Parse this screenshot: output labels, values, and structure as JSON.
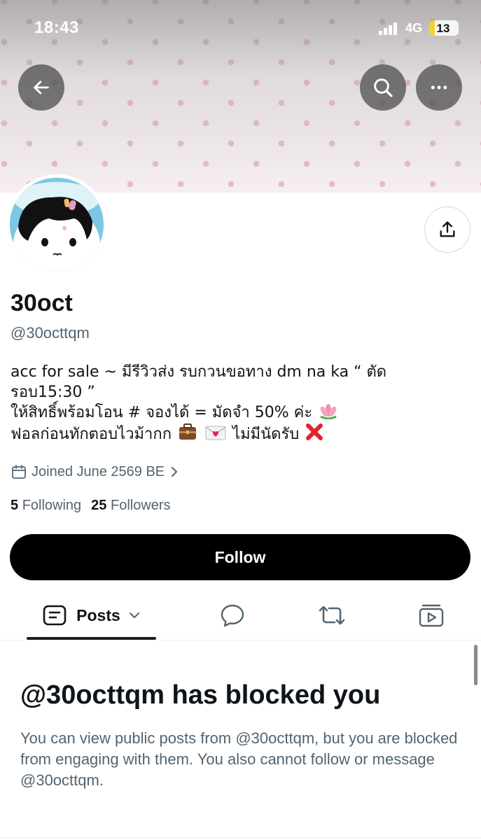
{
  "status_bar": {
    "time": "18:43",
    "network": "4G",
    "battery": "13",
    "battery_color": "#f2d036"
  },
  "header": {
    "back_icon": "arrow-left-icon",
    "search_icon": "search-icon",
    "more_icon": "more-horizontal-icon",
    "share_icon": "share-icon"
  },
  "profile": {
    "display_name": "30oct",
    "handle": "@30octtqm",
    "bio_lines": [
      "acc for sale ~ มีรีวิวส่ง รบกวนขอทาง dm na ka “ ตัด",
      "รอบ15:30 ”",
      "ให้สิทธิ์พร้อมโอน # จองได้ = มัดจำ 50% ค่ะ",
      "ฟอลก่อนทักตอบไวม้ากก",
      "ไม่มีนัดรับ"
    ],
    "bio_emojis": [
      "lotus-icon",
      "briefcase-icon",
      "love-letter-icon",
      "cross-mark-icon"
    ],
    "joined": "Joined June 2569 BE",
    "following_count": "5",
    "following_label": "Following",
    "followers_count": "25",
    "followers_label": "Followers",
    "follow_button": "Follow"
  },
  "tabs": {
    "posts_label": "Posts",
    "items": [
      "posts-tab",
      "replies-tab",
      "reposts-tab",
      "media-tab"
    ]
  },
  "blocked": {
    "title": "@30octtqm has blocked you",
    "message": "You can view public posts from @30octtqm, but you are blocked from engaging with them. You also cannot follow or message @30octtqm."
  },
  "colors": {
    "primary_text": "#0f1419",
    "secondary_text": "#536471",
    "button_bg": "#000000",
    "banner_dot": "#e7bccb"
  }
}
